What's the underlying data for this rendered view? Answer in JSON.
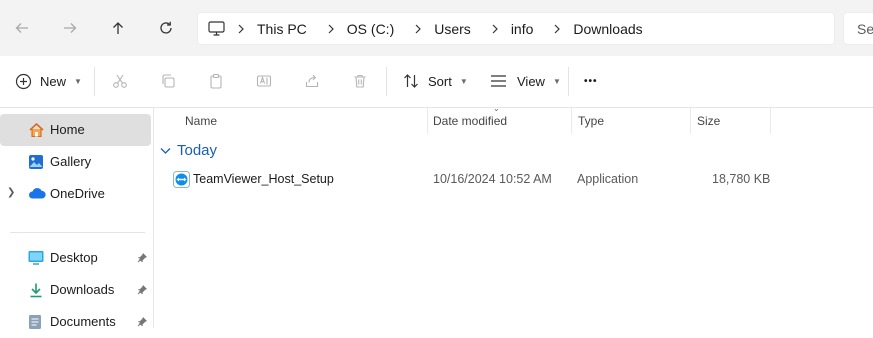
{
  "nav": {
    "back_icon": "arrow-left-icon",
    "forward_icon": "arrow-right-icon",
    "up_icon": "arrow-up-icon",
    "refresh_icon": "refresh-icon",
    "breadcrumb": [
      "This PC",
      "OS (C:)",
      "Users",
      "info",
      "Downloads"
    ],
    "search_placeholder": "Se"
  },
  "toolbar": {
    "new_label": "New",
    "sort_label": "Sort",
    "view_label": "View",
    "more_label": "•••"
  },
  "sidebar": {
    "items": [
      {
        "label": "Home",
        "icon": "home-icon"
      },
      {
        "label": "Gallery",
        "icon": "gallery-icon"
      },
      {
        "label": "OneDrive",
        "icon": "cloud-icon"
      },
      {
        "label": "Desktop",
        "icon": "desktop-icon"
      },
      {
        "label": "Downloads",
        "icon": "download-icon"
      },
      {
        "label": "Documents",
        "icon": "documents-icon"
      }
    ]
  },
  "columns": {
    "name": "Name",
    "date": "Date modified",
    "type": "Type",
    "size": "Size"
  },
  "groups": [
    {
      "label": "Today",
      "files": [
        {
          "name": "TeamViewer_Host_Setup",
          "date": "10/16/2024 10:52 AM",
          "type": "Application",
          "size": "18,780 KB",
          "icon": "teamviewer-icon"
        }
      ]
    }
  ],
  "colors": {
    "accent": "#0067c0",
    "selection": "#dfdfdf",
    "group_text": "#1a5fb4"
  }
}
